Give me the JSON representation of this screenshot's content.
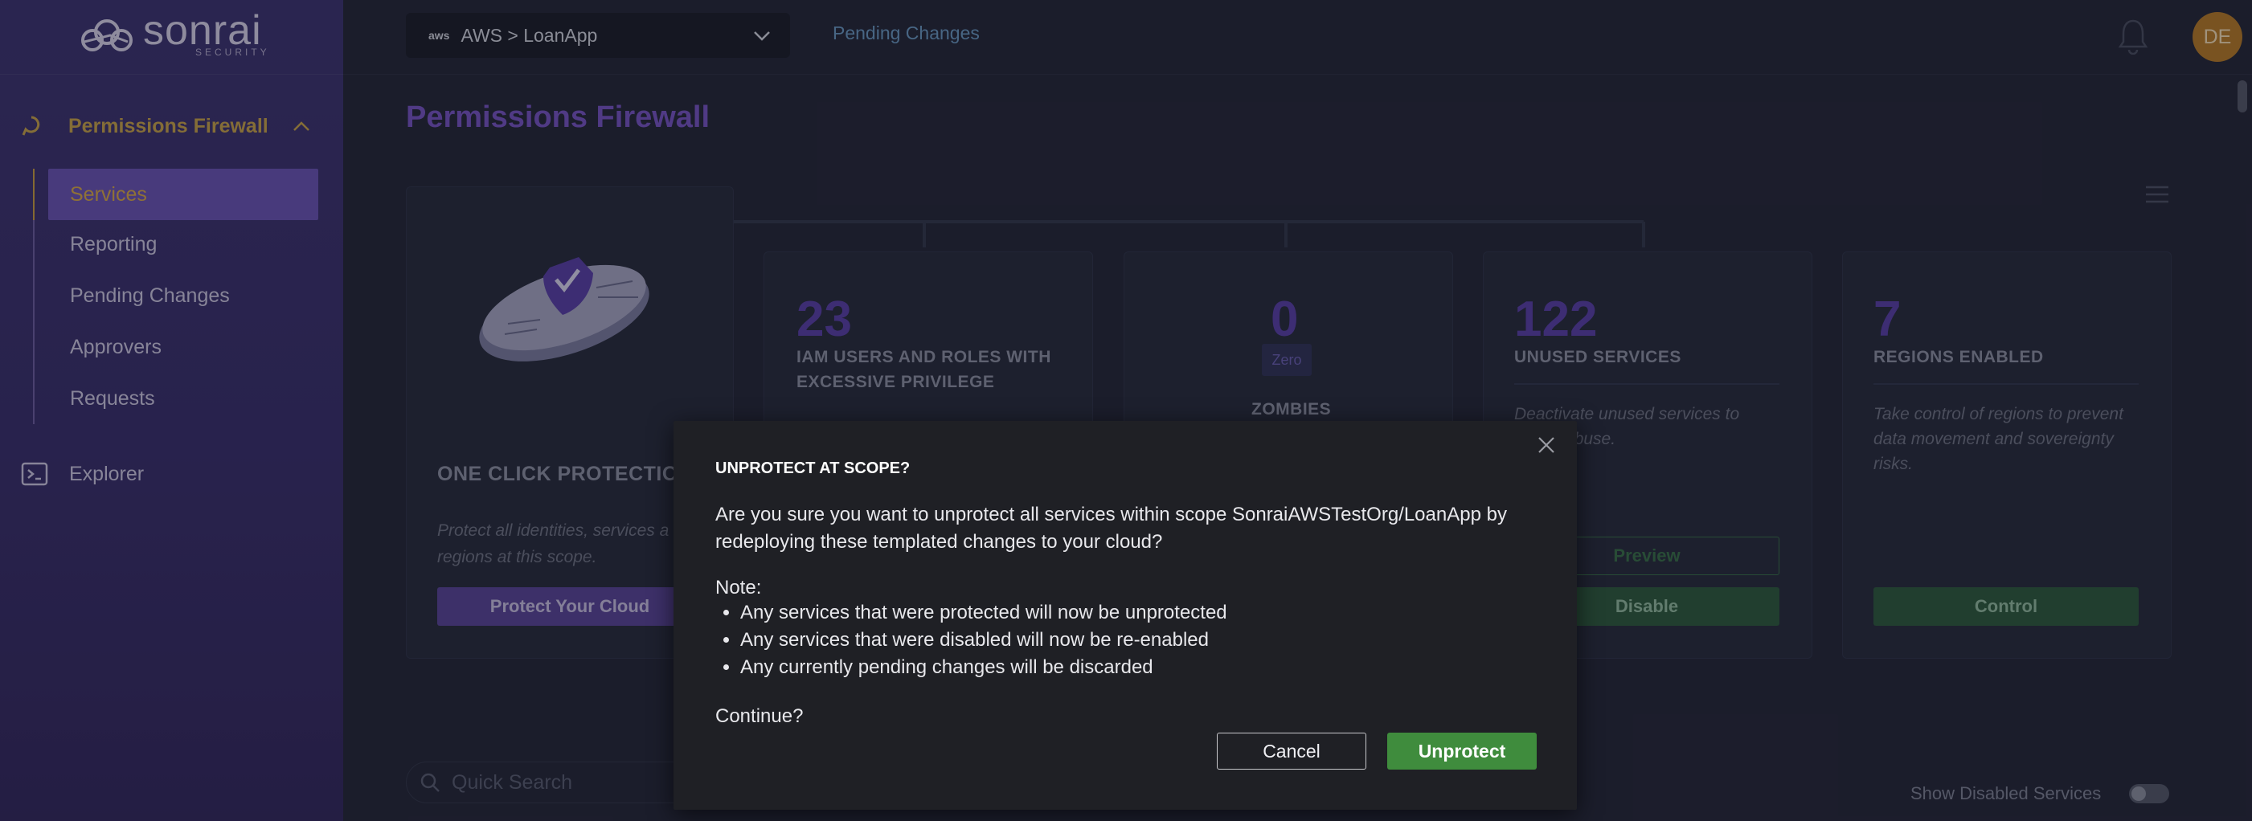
{
  "sidebar": {
    "logo_text": "sonrai",
    "logo_sub": "SECURITY",
    "section_title": "Permissions Firewall",
    "items": [
      {
        "label": "Services",
        "active": true
      },
      {
        "label": "Reporting"
      },
      {
        "label": "Pending Changes"
      },
      {
        "label": "Approvers"
      },
      {
        "label": "Requests"
      }
    ],
    "explorer_label": "Explorer"
  },
  "header": {
    "scope_provider": "aws",
    "scope_value": "AWS > LoanApp",
    "pending_link": "Pending Changes",
    "avatar_initials": "DE"
  },
  "main": {
    "title": "Permissions Firewall",
    "protection_card": {
      "heading": "ONE CLICK PROTECTION",
      "desc_line1": "Protect all identities, services a",
      "desc_line2": "regions at this scope.",
      "button": "Protect Your Cloud"
    },
    "stats": [
      {
        "number": "23",
        "heading_line1": "IAM USERS AND ROLES WITH",
        "heading_line2": "EXCESSIVE PRIVILEGE"
      },
      {
        "number": "0",
        "badge": "Zero",
        "heading": "ZOMBIES"
      },
      {
        "number": "122",
        "heading": "UNUSED SERVICES",
        "desc_line1": "Deactivate unused services to",
        "desc_line2": "tacker abuse.",
        "preview_button": "Preview",
        "action_button": "Disable"
      },
      {
        "number": "7",
        "heading": "REGIONS ENABLED",
        "desc_line1": "Take control of regions to prevent",
        "desc_line2": "data movement and sovereignty",
        "desc_line3": "risks.",
        "action_button": "Control"
      }
    ],
    "search_placeholder": "Quick Search",
    "show_disabled_label": "Show Disabled Services"
  },
  "modal": {
    "title": "UNPROTECT AT SCOPE?",
    "body": "Are you sure you want to unprotect all services within scope SonraiAWSTestOrg/LoanApp by redeploying these templated changes to your cloud?",
    "note_label": "Note:",
    "notes": [
      "Any services that were protected will now be unprotected",
      "Any services that were disabled will now be re-enabled",
      "Any currently pending changes will be discarded"
    ],
    "continue_text": "Continue?",
    "cancel_label": "Cancel",
    "confirm_label": "Unprotect"
  },
  "colors": {
    "accent_purple": "#7753c4",
    "confirm_green": "#3f8c3d",
    "gold": "#c7a24c"
  }
}
